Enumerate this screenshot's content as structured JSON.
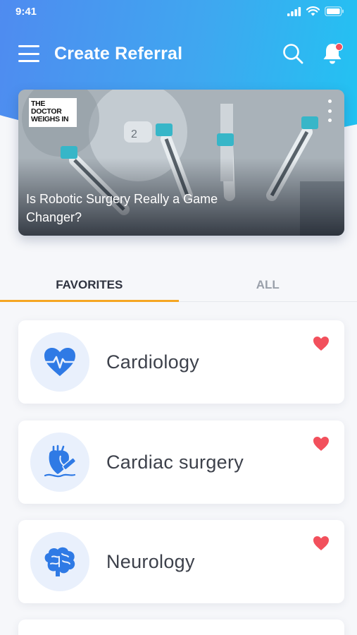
{
  "status_bar": {
    "time": "9:41"
  },
  "app_bar": {
    "title": "Create Referral"
  },
  "banner": {
    "logo_text": "THE DOCTOR WEIGHS IN",
    "headline": "Is Robotic Surgery Really a Game Changer?"
  },
  "tabs": [
    {
      "label": "FAVORITES",
      "active": true
    },
    {
      "label": "ALL",
      "active": false
    }
  ],
  "specialties": [
    {
      "label": "Cardiology",
      "icon": "heart-pulse-icon",
      "favorite": true
    },
    {
      "label": "Cardiac surgery",
      "icon": "heart-surgery-icon",
      "favorite": true
    },
    {
      "label": "Neurology",
      "icon": "brain-icon",
      "favorite": true
    }
  ],
  "colors": {
    "header_gradient_start": "#4f8bf0",
    "header_gradient_end": "#22c3f2",
    "accent_tab": "#f5a623",
    "favorite_heart": "#f2505c",
    "icon_blue": "#2f7ae5"
  }
}
